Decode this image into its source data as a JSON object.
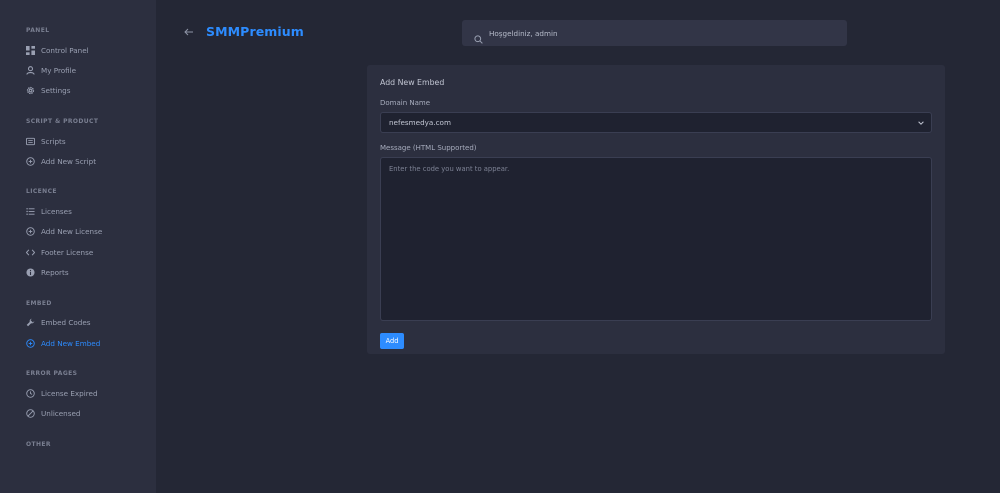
{
  "brand": "SMMPremium",
  "search": {
    "placeholder": "Hoşgeldiniz, admin"
  },
  "sidebar": {
    "groups": [
      {
        "title": "PANEL",
        "items": [
          {
            "label": "Control Panel",
            "icon": "dashboard-icon"
          },
          {
            "label": "My Profile",
            "icon": "user-icon"
          },
          {
            "label": "Settings",
            "icon": "gear-icon"
          }
        ]
      },
      {
        "title": "SCRIPT & PRODUCT",
        "items": [
          {
            "label": "Scripts",
            "icon": "list-icon"
          },
          {
            "label": "Add New Script",
            "icon": "plus-circle-icon"
          }
        ]
      },
      {
        "title": "LICENCE",
        "items": [
          {
            "label": "Licenses",
            "icon": "list-icon"
          },
          {
            "label": "Add New License",
            "icon": "plus-circle-icon"
          },
          {
            "label": "Footer License",
            "icon": "code-icon"
          },
          {
            "label": "Reports",
            "icon": "info-icon"
          }
        ]
      },
      {
        "title": "EMBED",
        "items": [
          {
            "label": "Embed Codes",
            "icon": "wrench-icon"
          },
          {
            "label": "Add New Embed",
            "icon": "plus-circle-icon",
            "active": true
          }
        ]
      },
      {
        "title": "ERROR PAGES",
        "items": [
          {
            "label": "License Expired",
            "icon": "clock-icon"
          },
          {
            "label": "Unlicensed",
            "icon": "ban-icon"
          }
        ]
      },
      {
        "title": "OTHER",
        "items": []
      }
    ]
  },
  "form": {
    "title": "Add New Embed",
    "domain_label": "Domain Name",
    "domain_value": "nefesmedya.com",
    "message_label": "Message (HTML Supported)",
    "message_placeholder": "Enter the code you want to appear.",
    "submit_label": "Add"
  },
  "colors": {
    "accent": "#2d8cff",
    "background": "#242735",
    "sidebar": "#2c2f3f"
  }
}
